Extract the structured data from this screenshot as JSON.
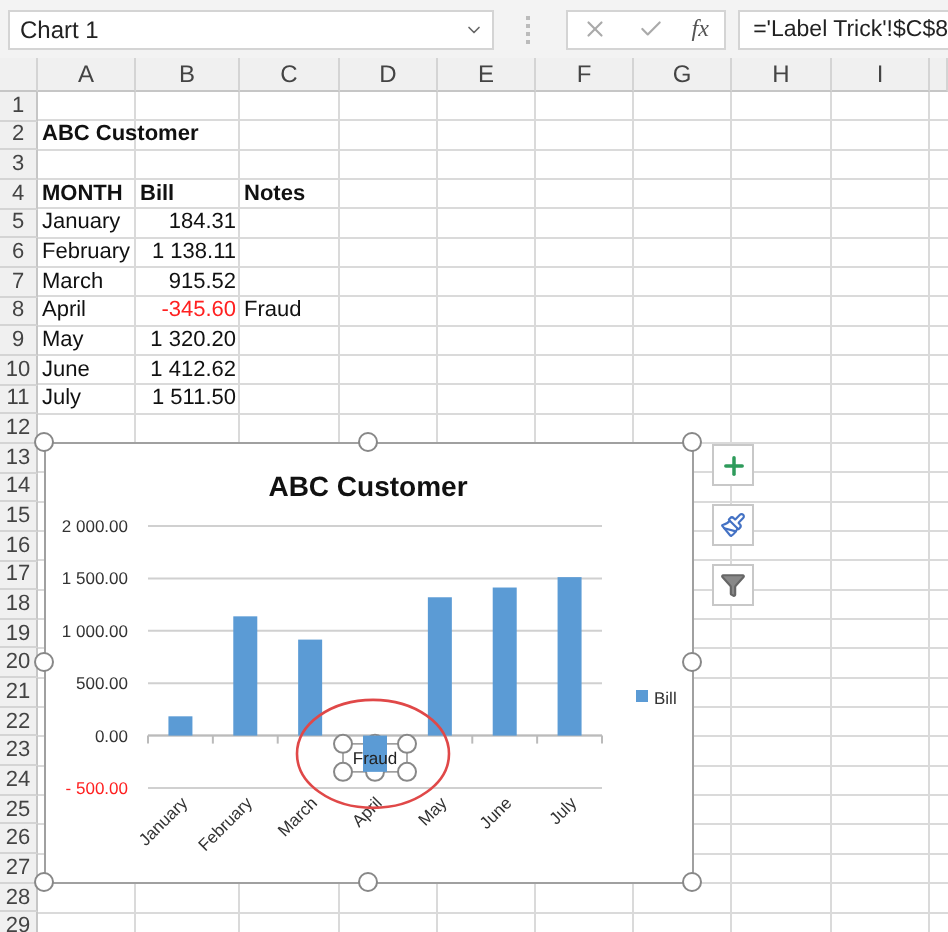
{
  "name_box": {
    "value": "Chart 1"
  },
  "formula_bar": {
    "function_label": "fx",
    "value": "='Label Trick'!$C$8"
  },
  "sheet": {
    "columns": [
      "A",
      "B",
      "C",
      "D",
      "E",
      "F",
      "G",
      "H",
      "I"
    ],
    "rows": [
      {
        "number": "1"
      },
      {
        "number": "2",
        "cells": [
          {
            "text": "ABC Customer",
            "kind": "bold"
          }
        ]
      },
      {
        "number": "3"
      },
      {
        "number": "4",
        "cells": [
          {
            "text": "MONTH",
            "kind": "bold"
          },
          {
            "text": "Bill",
            "kind": "bold"
          },
          {
            "text": "Notes",
            "kind": "bold"
          }
        ]
      },
      {
        "number": "5",
        "cells": [
          {
            "text": "January",
            "kind": "plain"
          },
          {
            "text": "184.31",
            "kind": "number"
          }
        ]
      },
      {
        "number": "6",
        "cells": [
          {
            "text": "February",
            "kind": "plain"
          },
          {
            "text": "1 138.11",
            "kind": "number"
          }
        ]
      },
      {
        "number": "7",
        "cells": [
          {
            "text": "March",
            "kind": "plain"
          },
          {
            "text": "915.52",
            "kind": "number"
          }
        ]
      },
      {
        "number": "8",
        "cells": [
          {
            "text": "April",
            "kind": "plain"
          },
          {
            "text": "-345.60",
            "kind": "negative"
          },
          {
            "text": "Fraud",
            "kind": "plain"
          }
        ]
      },
      {
        "number": "9",
        "cells": [
          {
            "text": "May",
            "kind": "plain"
          },
          {
            "text": "1 320.20",
            "kind": "number"
          }
        ]
      },
      {
        "number": "10",
        "cells": [
          {
            "text": "June",
            "kind": "plain"
          },
          {
            "text": "1 412.62",
            "kind": "number"
          }
        ]
      },
      {
        "number": "11",
        "cells": [
          {
            "text": "July",
            "kind": "plain"
          },
          {
            "text": "1 511.50",
            "kind": "number"
          }
        ]
      },
      {
        "number": "12"
      },
      {
        "number": "13"
      },
      {
        "number": "14"
      },
      {
        "number": "15"
      },
      {
        "number": "16"
      },
      {
        "number": "17"
      },
      {
        "number": "18"
      },
      {
        "number": "19"
      },
      {
        "number": "20"
      },
      {
        "number": "21"
      },
      {
        "number": "22"
      },
      {
        "number": "23"
      },
      {
        "number": "24"
      },
      {
        "number": "25"
      },
      {
        "number": "26"
      },
      {
        "number": "27"
      },
      {
        "number": "28"
      },
      {
        "number": "29"
      }
    ]
  },
  "chart": {
    "selected": true,
    "label_selected": true,
    "chart_data": {
      "type": "bar",
      "title": "ABC Customer",
      "grid": true,
      "categories": [
        "January",
        "February",
        "March",
        "April",
        "May",
        "June",
        "July"
      ],
      "series": [
        {
          "name": "Bill",
          "color": "#5b9bd5",
          "values": [
            184,
            1138,
            916,
            -346,
            1320,
            1413,
            1512
          ]
        }
      ],
      "ylim": [
        -500,
        2000
      ],
      "yticks": [
        {
          "value": -500,
          "label": "- 500.00"
        },
        {
          "value": 0,
          "label": "0.00"
        },
        {
          "value": 500,
          "label": "500.00"
        },
        {
          "value": 1000,
          "label": "1 000.00"
        },
        {
          "value": 1500,
          "label": "1 500.00"
        },
        {
          "value": 2000,
          "label": "2 000.00"
        }
      ],
      "annotations": [
        {
          "text": "Fraud",
          "x": "April",
          "y": -346
        }
      ]
    }
  }
}
